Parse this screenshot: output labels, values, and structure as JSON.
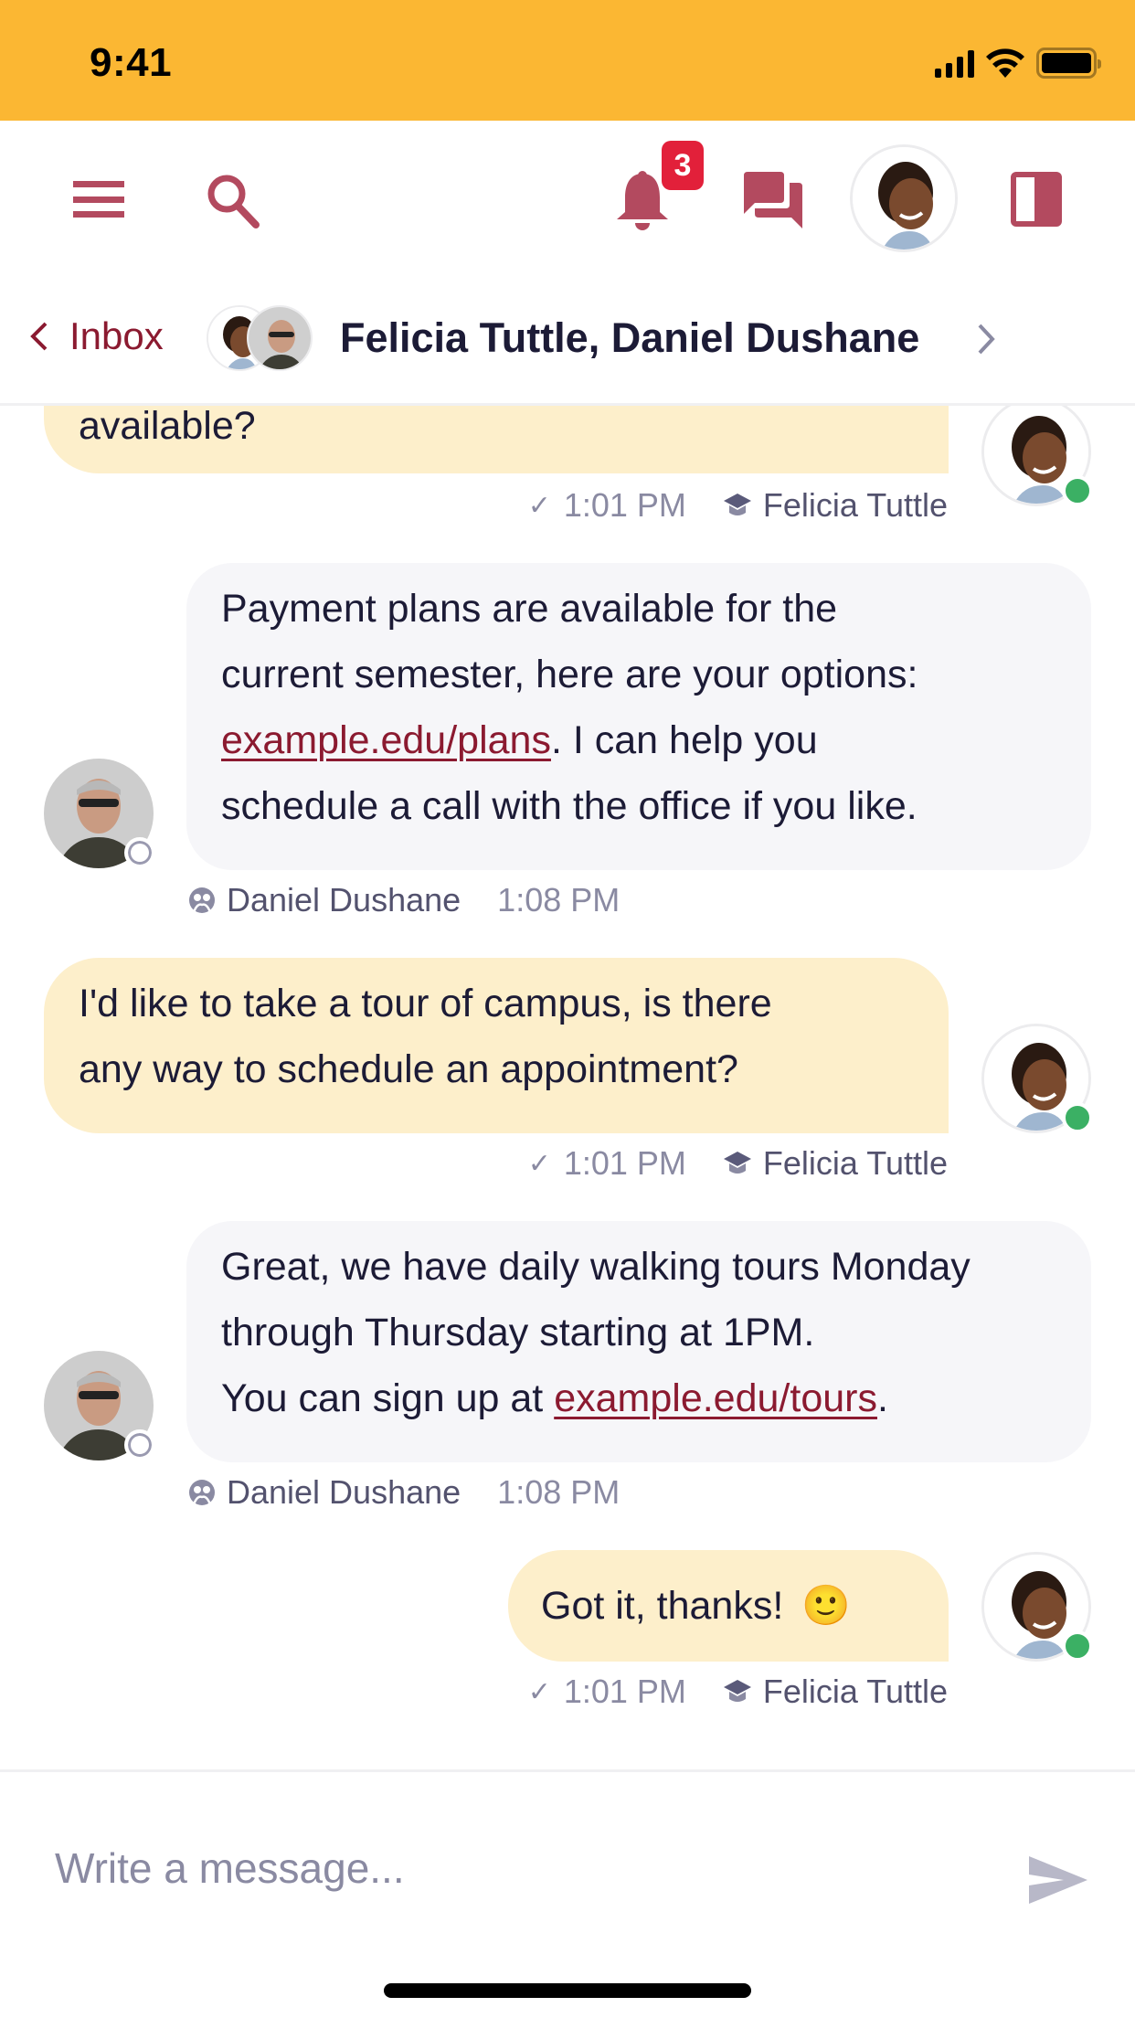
{
  "status_bar": {
    "time": "9:41",
    "icons": [
      "cellular-signal-icon",
      "wifi-icon",
      "battery-icon"
    ]
  },
  "top_nav": {
    "menu_icon": "hamburger-menu-icon",
    "search_icon": "search-icon",
    "notifications": {
      "icon": "bell-icon",
      "badge_count": "3"
    },
    "messages_icon": "chat-bubbles-icon",
    "profile_avatar": "Felicia Tuttle",
    "panel_icon": "sidebar-panel-icon"
  },
  "conversation_header": {
    "back_label": "Inbox",
    "participants": [
      "Felicia Tuttle",
      "Daniel Dushane"
    ],
    "title": "Felicia Tuttle, Daniel Dushane"
  },
  "messages": [
    {
      "direction": "outgoing",
      "text": "available?",
      "time": "1:01 PM",
      "sender": "Felicia Tuttle",
      "sender_role_icon": "graduation-cap-icon",
      "status_icon": "check-icon",
      "presence": "online"
    },
    {
      "direction": "incoming",
      "text_parts": [
        "Payment plans are available for the current semester, here are your options: ",
        "example.edu/plans",
        ". I can help you schedule a call with the office if you like."
      ],
      "lines": [
        "Payment plans are available for the",
        "current semester, here are your options:",
        "example.edu/plans",
        ". I can help you",
        "schedule a call with the office if you like."
      ],
      "link": "example.edu/plans",
      "time": "1:08 PM",
      "sender": "Daniel Dushane",
      "sender_role_icon": "staff-group-icon",
      "presence": "offline"
    },
    {
      "direction": "outgoing",
      "lines": [
        "I'd like to take a tour of campus, is there",
        "any way to schedule an appointment?"
      ],
      "time": "1:01 PM",
      "sender": "Felicia Tuttle",
      "sender_role_icon": "graduation-cap-icon",
      "status_icon": "check-icon",
      "presence": "online"
    },
    {
      "direction": "incoming",
      "lines": [
        "Great, we have daily walking tours Monday",
        "through Thursday starting at 1PM.",
        "You can sign up at ",
        "example.edu/tours",
        "."
      ],
      "link": "example.edu/tours",
      "time": "1:08 PM",
      "sender": "Daniel Dushane",
      "sender_role_icon": "staff-group-icon",
      "presence": "offline"
    },
    {
      "direction": "outgoing",
      "text": "Got it, thanks!",
      "emoji": "🙂",
      "time": "1:01 PM",
      "sender": "Felicia Tuttle",
      "sender_role_icon": "graduation-cap-icon",
      "status_icon": "check-icon",
      "presence": "online"
    }
  ],
  "composer": {
    "placeholder": "Write a message...",
    "value": "",
    "send_icon": "send-icon"
  },
  "colors": {
    "status_bar": "#fbb733",
    "brand": "#b34a5f",
    "link": "#8b1a30",
    "badge": "#e2203a",
    "outgoing_bubble": "#fdefcb",
    "incoming_bubble": "#f6f6f9",
    "online": "#3bb064",
    "muted_text": "#8a8aa2"
  }
}
